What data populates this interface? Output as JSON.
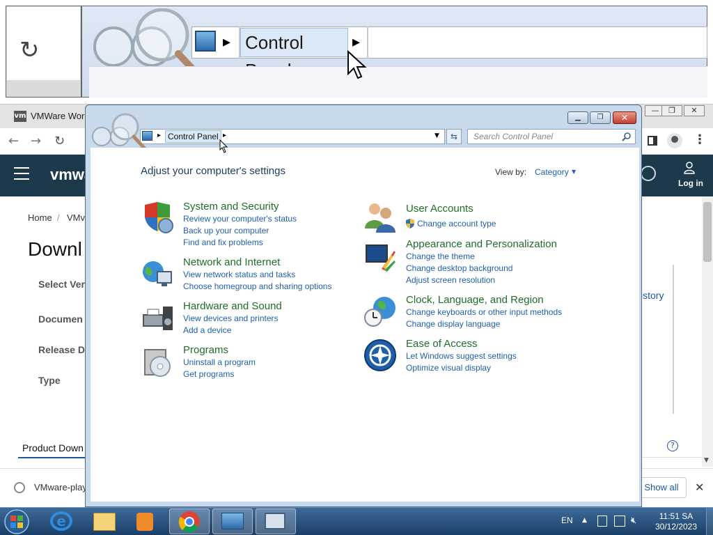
{
  "magnifier": {
    "breadcrumb": "Control Panel"
  },
  "browser": {
    "tab_title": "VMWare Work",
    "logo_text": "vmwa",
    "login_label": "Log in",
    "breadcrumb_home": "Home",
    "breadcrumb_sep": "/",
    "breadcrumb_next": "VMv",
    "page_title": "Downl",
    "fields": [
      "Select Ver",
      "Documen",
      "Release D",
      "Type"
    ],
    "history_text": "istory",
    "product_tab": "Product Down",
    "download_file": "VMware-play",
    "show_all_label": "Show all",
    "close_label": "✕"
  },
  "control_panel": {
    "breadcrumb": "Control Panel",
    "search_placeholder": "Search Control Panel",
    "heading": "Adjust your computer's settings",
    "view_by_label": "View by:",
    "view_by_value": "Category",
    "categories_left": [
      {
        "title": "System and Security",
        "links": [
          "Review your computer's status",
          "Back up your computer",
          "Find and fix problems"
        ]
      },
      {
        "title": "Network and Internet",
        "links": [
          "View network status and tasks",
          "Choose homegroup and sharing options"
        ]
      },
      {
        "title": "Hardware and Sound",
        "links": [
          "View devices and printers",
          "Add a device"
        ]
      },
      {
        "title": "Programs",
        "links": [
          "Uninstall a program",
          "Get programs"
        ]
      }
    ],
    "categories_right": [
      {
        "title": "User Accounts",
        "links": [
          "Change account type"
        ]
      },
      {
        "title": "Appearance and Personalization",
        "links": [
          "Change the theme",
          "Change desktop background",
          "Adjust screen resolution"
        ]
      },
      {
        "title": "Clock, Language, and Region",
        "links": [
          "Change keyboards or other input methods",
          "Change display language"
        ]
      },
      {
        "title": "Ease of Access",
        "links": [
          "Let Windows suggest settings",
          "Optimize visual display"
        ]
      }
    ]
  },
  "taskbar": {
    "language": "EN",
    "time": "11:51 SA",
    "date": "30/12/2023"
  }
}
